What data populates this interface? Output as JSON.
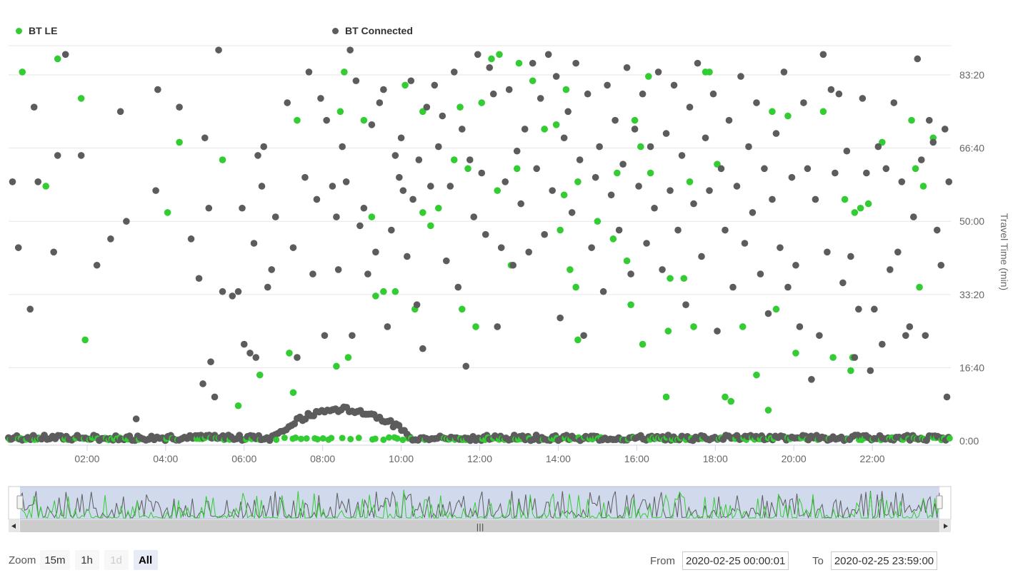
{
  "chart_data": {
    "type": "scatter",
    "ylabel": "Travel Time (min)",
    "x_ticks": [
      "02:00",
      "04:00",
      "06:00",
      "08:00",
      "10:00",
      "12:00",
      "14:00",
      "16:00",
      "18:00",
      "20:00",
      "22:00"
    ],
    "y_ticks": [
      "0:00",
      "16:40",
      "33:20",
      "50:00",
      "66:40",
      "83:20"
    ],
    "y_tick_values": [
      0,
      16.67,
      33.33,
      50,
      66.67,
      83.33
    ],
    "x_range_hours": [
      0,
      24
    ],
    "y_range_min": [
      0,
      90
    ],
    "grid": true,
    "legend_position": "top",
    "series": [
      {
        "name": "BT LE",
        "color": "#33cc33",
        "points": [
          [
            0.35,
            84
          ],
          [
            1.25,
            87
          ],
          [
            0.95,
            58
          ],
          [
            1.85,
            78
          ],
          [
            1.95,
            23
          ],
          [
            4.05,
            52
          ],
          [
            4.35,
            68
          ],
          [
            5.45,
            64
          ],
          [
            5.85,
            8
          ],
          [
            6.4,
            15
          ],
          [
            7.15,
            20
          ],
          [
            7.35,
            73
          ],
          [
            7.25,
            11
          ],
          [
            8.35,
            17
          ],
          [
            8.45,
            75
          ],
          [
            8.55,
            84
          ],
          [
            8.65,
            19
          ],
          [
            9.05,
            73
          ],
          [
            9.25,
            51
          ],
          [
            9.35,
            33
          ],
          [
            9.55,
            34
          ],
          [
            9.85,
            34
          ],
          [
            10.1,
            81
          ],
          [
            10.35,
            30
          ],
          [
            10.55,
            52
          ],
          [
            10.55,
            75
          ],
          [
            10.75,
            49
          ],
          [
            10.95,
            53
          ],
          [
            11.35,
            64
          ],
          [
            11.5,
            76
          ],
          [
            11.55,
            30
          ],
          [
            11.7,
            62
          ],
          [
            11.9,
            26
          ],
          [
            12.05,
            77
          ],
          [
            12.3,
            87
          ],
          [
            12.45,
            57
          ],
          [
            12.5,
            88
          ],
          [
            12.8,
            40
          ],
          [
            12.95,
            62
          ],
          [
            13.0,
            86
          ],
          [
            13.35,
            82
          ],
          [
            13.65,
            71
          ],
          [
            13.95,
            72
          ],
          [
            14.05,
            48
          ],
          [
            14.15,
            56
          ],
          [
            14.2,
            80
          ],
          [
            14.3,
            39
          ],
          [
            14.45,
            35
          ],
          [
            14.5,
            23
          ],
          [
            14.5,
            59
          ],
          [
            15.0,
            50
          ],
          [
            15.4,
            46
          ],
          [
            15.5,
            61
          ],
          [
            15.75,
            41
          ],
          [
            15.85,
            31
          ],
          [
            15.95,
            73
          ],
          [
            16.1,
            67
          ],
          [
            16.15,
            22
          ],
          [
            16.3,
            83
          ],
          [
            16.35,
            61
          ],
          [
            16.75,
            10
          ],
          [
            16.8,
            25
          ],
          [
            16.85,
            37
          ],
          [
            17.2,
            37
          ],
          [
            17.35,
            59
          ],
          [
            17.45,
            26
          ],
          [
            17.75,
            84
          ],
          [
            17.85,
            84
          ],
          [
            18.05,
            63
          ],
          [
            18.25,
            10
          ],
          [
            18.4,
            9
          ],
          [
            18.7,
            26
          ],
          [
            19.05,
            15
          ],
          [
            19.35,
            7
          ],
          [
            19.45,
            75
          ],
          [
            19.55,
            30
          ],
          [
            19.85,
            74
          ],
          [
            20.05,
            20
          ],
          [
            20.75,
            75
          ],
          [
            21.0,
            19
          ],
          [
            21.3,
            55
          ],
          [
            21.45,
            16
          ],
          [
            21.5,
            19
          ],
          [
            21.55,
            52
          ],
          [
            21.7,
            53
          ],
          [
            21.9,
            54
          ],
          [
            22.25,
            68
          ],
          [
            23.0,
            73
          ],
          [
            23.1,
            62
          ],
          [
            23.2,
            35
          ],
          [
            23.3,
            58
          ],
          [
            23.55,
            69
          ]
        ]
      },
      {
        "name": "BT Connected",
        "color": "#5c5c5c",
        "points": [
          [
            0.1,
            59
          ],
          [
            0.25,
            44
          ],
          [
            0.55,
            30
          ],
          [
            0.65,
            76
          ],
          [
            0.75,
            59
          ],
          [
            1.15,
            43
          ],
          [
            1.25,
            65
          ],
          [
            1.45,
            88
          ],
          [
            1.85,
            65
          ],
          [
            2.25,
            40
          ],
          [
            2.6,
            46
          ],
          [
            2.85,
            75
          ],
          [
            3.0,
            50
          ],
          [
            3.25,
            5
          ],
          [
            3.75,
            57
          ],
          [
            3.8,
            80
          ],
          [
            4.35,
            76
          ],
          [
            4.65,
            46
          ],
          [
            4.85,
            37
          ],
          [
            4.95,
            13
          ],
          [
            5.0,
            69
          ],
          [
            5.1,
            53
          ],
          [
            5.15,
            18
          ],
          [
            5.25,
            10
          ],
          [
            5.35,
            89
          ],
          [
            5.45,
            34
          ],
          [
            5.7,
            33
          ],
          [
            5.85,
            34
          ],
          [
            5.95,
            53
          ],
          [
            6.0,
            22
          ],
          [
            6.15,
            20
          ],
          [
            6.25,
            45
          ],
          [
            6.3,
            19
          ],
          [
            6.35,
            65
          ],
          [
            6.45,
            58
          ],
          [
            6.5,
            67
          ],
          [
            6.6,
            35
          ],
          [
            6.7,
            39
          ],
          [
            6.8,
            51
          ],
          [
            7.1,
            77
          ],
          [
            7.25,
            44
          ],
          [
            7.35,
            19
          ],
          [
            7.55,
            60
          ],
          [
            7.65,
            84
          ],
          [
            7.75,
            38
          ],
          [
            7.85,
            55
          ],
          [
            7.95,
            78
          ],
          [
            8.05,
            24
          ],
          [
            8.1,
            73
          ],
          [
            8.25,
            58
          ],
          [
            8.35,
            51
          ],
          [
            8.4,
            39
          ],
          [
            8.5,
            67
          ],
          [
            8.6,
            59
          ],
          [
            8.7,
            89
          ],
          [
            8.75,
            24
          ],
          [
            8.85,
            82
          ],
          [
            8.95,
            49
          ],
          [
            9.05,
            53
          ],
          [
            9.15,
            38
          ],
          [
            9.25,
            72
          ],
          [
            9.35,
            43
          ],
          [
            9.45,
            77
          ],
          [
            9.55,
            80
          ],
          [
            9.65,
            26
          ],
          [
            9.75,
            48
          ],
          [
            9.85,
            65
          ],
          [
            9.95,
            60
          ],
          [
            10.0,
            69
          ],
          [
            10.05,
            57
          ],
          [
            10.15,
            42
          ],
          [
            10.25,
            82
          ],
          [
            10.3,
            55
          ],
          [
            10.4,
            31
          ],
          [
            10.45,
            64
          ],
          [
            10.55,
            21
          ],
          [
            10.65,
            76
          ],
          [
            10.75,
            58
          ],
          [
            10.85,
            81
          ],
          [
            10.95,
            67
          ],
          [
            11.05,
            74
          ],
          [
            11.15,
            41
          ],
          [
            11.25,
            58
          ],
          [
            11.35,
            84
          ],
          [
            11.45,
            35
          ],
          [
            11.55,
            71
          ],
          [
            11.65,
            17
          ],
          [
            11.75,
            64
          ],
          [
            11.85,
            51
          ],
          [
            11.95,
            88
          ],
          [
            12.05,
            61
          ],
          [
            12.15,
            47
          ],
          [
            12.25,
            85
          ],
          [
            12.35,
            79
          ],
          [
            12.45,
            26
          ],
          [
            12.55,
            44
          ],
          [
            12.65,
            59
          ],
          [
            12.75,
            80
          ],
          [
            12.85,
            40
          ],
          [
            12.95,
            66
          ],
          [
            13.05,
            54
          ],
          [
            13.15,
            71
          ],
          [
            13.25,
            43
          ],
          [
            13.35,
            86
          ],
          [
            13.45,
            62
          ],
          [
            13.55,
            78
          ],
          [
            13.65,
            47
          ],
          [
            13.75,
            88
          ],
          [
            13.85,
            57
          ],
          [
            13.95,
            83
          ],
          [
            14.05,
            28
          ],
          [
            14.15,
            69
          ],
          [
            14.25,
            75
          ],
          [
            14.35,
            52
          ],
          [
            14.45,
            86
          ],
          [
            14.55,
            64
          ],
          [
            14.65,
            24
          ],
          [
            14.75,
            79
          ],
          [
            14.85,
            44
          ],
          [
            14.95,
            60
          ],
          [
            15.05,
            67
          ],
          [
            15.15,
            34
          ],
          [
            15.25,
            81
          ],
          [
            15.35,
            56
          ],
          [
            15.45,
            73
          ],
          [
            15.55,
            48
          ],
          [
            15.65,
            63
          ],
          [
            15.75,
            85
          ],
          [
            15.85,
            38
          ],
          [
            15.95,
            71
          ],
          [
            16.05,
            58
          ],
          [
            16.15,
            79
          ],
          [
            16.25,
            45
          ],
          [
            16.35,
            67
          ],
          [
            16.45,
            53
          ],
          [
            16.55,
            84
          ],
          [
            16.65,
            39
          ],
          [
            16.75,
            70
          ],
          [
            16.85,
            57
          ],
          [
            16.95,
            81
          ],
          [
            17.05,
            48
          ],
          [
            17.15,
            65
          ],
          [
            17.25,
            31
          ],
          [
            17.35,
            76
          ],
          [
            17.45,
            54
          ],
          [
            17.55,
            86
          ],
          [
            17.65,
            42
          ],
          [
            17.75,
            69
          ],
          [
            17.85,
            57
          ],
          [
            17.95,
            79
          ],
          [
            18.05,
            25
          ],
          [
            18.15,
            62
          ],
          [
            18.25,
            48
          ],
          [
            18.35,
            73
          ],
          [
            18.45,
            35
          ],
          [
            18.55,
            58
          ],
          [
            18.65,
            83
          ],
          [
            18.75,
            45
          ],
          [
            18.85,
            67
          ],
          [
            18.95,
            52
          ],
          [
            19.05,
            77
          ],
          [
            19.15,
            38
          ],
          [
            19.25,
            62
          ],
          [
            19.35,
            29
          ],
          [
            19.45,
            55
          ],
          [
            19.55,
            70
          ],
          [
            19.65,
            44
          ],
          [
            19.75,
            84
          ],
          [
            19.85,
            35
          ],
          [
            19.95,
            60
          ],
          [
            20.05,
            40
          ],
          [
            20.15,
            26
          ],
          [
            20.25,
            77
          ],
          [
            20.35,
            62
          ],
          [
            20.45,
            14
          ],
          [
            20.55,
            55
          ],
          [
            20.65,
            24
          ],
          [
            20.75,
            88
          ],
          [
            20.85,
            43
          ],
          [
            20.95,
            80
          ],
          [
            21.05,
            61
          ],
          [
            21.15,
            79
          ],
          [
            21.25,
            36
          ],
          [
            21.35,
            66
          ],
          [
            21.45,
            42
          ],
          [
            21.55,
            19
          ],
          [
            21.65,
            30
          ],
          [
            21.75,
            78
          ],
          [
            21.85,
            61
          ],
          [
            21.95,
            16
          ],
          [
            22.05,
            30
          ],
          [
            22.15,
            67
          ],
          [
            22.25,
            22
          ],
          [
            22.35,
            62
          ],
          [
            22.45,
            39
          ],
          [
            22.55,
            77
          ],
          [
            22.65,
            43
          ],
          [
            22.75,
            59
          ],
          [
            22.85,
            24
          ],
          [
            22.95,
            26
          ],
          [
            23.05,
            51
          ],
          [
            23.15,
            87
          ],
          [
            23.25,
            64
          ],
          [
            23.35,
            24
          ],
          [
            23.45,
            73
          ],
          [
            23.55,
            68
          ],
          [
            23.65,
            48
          ],
          [
            23.75,
            40
          ],
          [
            23.85,
            71
          ],
          [
            23.9,
            10
          ],
          [
            23.95,
            59
          ]
        ],
        "baseline_note": "dense band of points near 0:00 across the whole day with a hump around 06:00-11:00"
      }
    ]
  },
  "navigator": {
    "series_colors": [
      "#33cc33",
      "#5c5c5c"
    ],
    "selection_fraction": [
      0.0,
      1.0
    ]
  },
  "controls": {
    "zoom_label": "Zoom",
    "buttons": [
      {
        "label": "15m",
        "state": "normal"
      },
      {
        "label": "1h",
        "state": "normal"
      },
      {
        "label": "1d",
        "state": "disabled"
      },
      {
        "label": "All",
        "state": "active"
      }
    ],
    "from_label": "From",
    "from_value": "2020-02-25 00:00:01",
    "to_label": "To",
    "to_value": "2020-02-25 23:59:00"
  }
}
